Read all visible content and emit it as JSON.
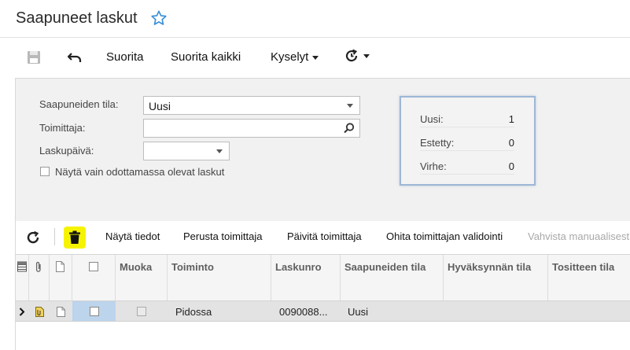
{
  "page": {
    "title": "Saapuneet laskut"
  },
  "toolbar": {
    "run_label": "Suorita",
    "run_all_label": "Suorita kaikki",
    "queries_label": "Kyselyt"
  },
  "filters": {
    "status_label": "Saapuneiden tila:",
    "status_value": "Uusi",
    "supplier_label": "Toimittaja:",
    "supplier_value": "",
    "invoice_date_label": "Laskupäivä:",
    "invoice_date_value": "",
    "pending_only_label": "Näytä vain odottamassa olevat laskut"
  },
  "stats": {
    "items": [
      {
        "label": "Uusi:",
        "value": "1"
      },
      {
        "label": "Estetty:",
        "value": "0"
      },
      {
        "label": "Virhe:",
        "value": "0"
      }
    ]
  },
  "grid_toolbar": {
    "show_details": "Näytä tiedot",
    "create_supplier": "Perusta toimittaja",
    "update_supplier": "Päivitä toimittaja",
    "skip_validation": "Ohita toimittajan validointi",
    "confirm_manual": "Vahvista manuaalisest"
  },
  "grid": {
    "columns": {
      "modified": "Muoka",
      "action": "Toiminto",
      "invoice_no": "Laskunro",
      "incoming_status": "Saapuneiden tila",
      "approval_status": "Hyväksynnän tila",
      "voucher_status": "Tositteen tila"
    },
    "rows": [
      {
        "action": "Pidossa",
        "invoice_no": "0090088...",
        "incoming_status": "Uusi"
      }
    ]
  },
  "colors": {
    "highlight": "#f6f300",
    "selection": "#bcd4ec",
    "star": "#3b8fd6"
  }
}
